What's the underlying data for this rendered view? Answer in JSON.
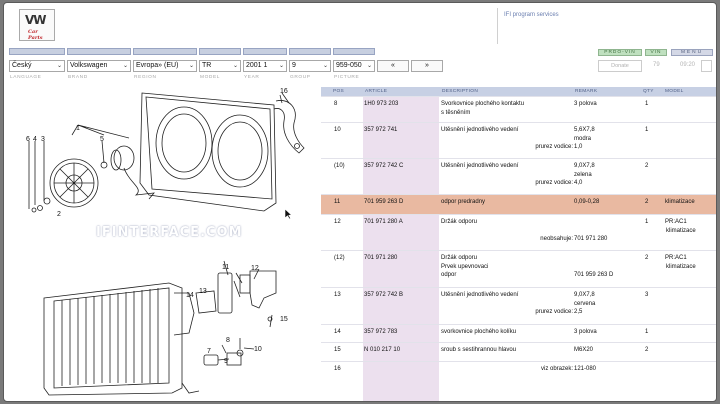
{
  "header": {
    "logo_text": "VW",
    "logo_sub": "Car Parts",
    "title": "IFI program services"
  },
  "status_pills": {
    "prod_vin": "PRDO-VIN",
    "vin": "VIN",
    "menu": "MENU"
  },
  "selectors": {
    "language": "Český",
    "brand": "Volkswagen",
    "region": "Evropa» (EU)",
    "model": "TR",
    "year": "2001",
    "year_sub": "1",
    "group": "9",
    "picture": "959-050",
    "prev_label": "«",
    "next_label": "»",
    "donate_label": "Donate",
    "count_a": "79",
    "count_b": "09:20"
  },
  "captions": {
    "language": "LANGUAGE",
    "brand": "BRAND",
    "region": "REGION",
    "model": "MODEL",
    "year": "YEAR",
    "group": "GROUP",
    "picture": "PICTURE"
  },
  "watermark": "IFINTERFACE.COM",
  "drawing_labels": [
    "16",
    "1",
    "6",
    "4",
    "3",
    "5",
    "2",
    "14",
    "13",
    "12",
    "15",
    "8",
    "10",
    "7",
    "9",
    "11"
  ],
  "table": {
    "headers": {
      "pos": "POS",
      "article": "ARTICLE",
      "description": "DESCRIPTION",
      "remark": "REMARK",
      "qty": "QTY",
      "model": "MODEL"
    },
    "rows": [
      {
        "pos": "8",
        "article": "1H0 973 203",
        "desc": [
          "Svorkovnice plochého kontaktu",
          "s těsněním"
        ],
        "remark": [
          "3 polova"
        ],
        "qty": "1",
        "model": []
      },
      {
        "pos": "10",
        "article": "357 972 741",
        "desc": [
          "Utěsnění jednotlivého vedení",
          "",
          "prurez vodice:"
        ],
        "remark": [
          "5,6X7,8",
          "modra",
          "1,0"
        ],
        "qty": "1",
        "model": []
      },
      {
        "pos": "(10)",
        "article": "357 972 742 C",
        "desc": [
          "Utěsnění jednotlivého vedení",
          "",
          "prurez vodice:"
        ],
        "remark": [
          "9,0X7,8",
          "zelena",
          "4,0"
        ],
        "qty": "2",
        "model": []
      },
      {
        "pos": "11",
        "article": "701 959 263 D",
        "desc": [
          "odpor predradny"
        ],
        "remark": [
          "0,09-0,28"
        ],
        "qty": "2",
        "model": [
          "klimatizace"
        ]
      },
      {
        "pos": "12",
        "article": "701 971 280 A",
        "desc": [
          "Držák odporu",
          "",
          "neobsahuje:"
        ],
        "remark": [
          "",
          "",
          "701 971 280"
        ],
        "qty": "1",
        "model": [
          "PR:AC1",
          "klimatizace"
        ]
      },
      {
        "pos": "(12)",
        "article": "701 971 280",
        "desc": [
          "Držák odporu",
          "Prvek upevnovaci",
          "odpor"
        ],
        "remark": [
          "",
          "",
          "701 959 263 D"
        ],
        "qty": "2",
        "model": [
          "PR:AC1",
          "klimatizace"
        ]
      },
      {
        "pos": "13",
        "article": "357 972 742 B",
        "desc": [
          "Utěsnění jednotlivého vedení",
          "",
          "prurez vodice:"
        ],
        "remark": [
          "9,0X7,8",
          "cervena",
          "2,5"
        ],
        "qty": "3",
        "model": []
      },
      {
        "pos": "14",
        "article": "357 972 783",
        "desc": [
          "svorkovnice plochého kolíku"
        ],
        "remark": [
          "3 polova"
        ],
        "qty": "1",
        "model": []
      },
      {
        "pos": "15",
        "article": "N   010 217 10",
        "desc": [
          "sroub s sestihrannou hlavou"
        ],
        "remark": [
          "M6X20"
        ],
        "qty": "2",
        "model": []
      },
      {
        "pos": "16",
        "article": "",
        "desc": [
          "viz obrazek:"
        ],
        "remark": [
          "121-080"
        ],
        "qty": "",
        "model": []
      }
    ]
  }
}
